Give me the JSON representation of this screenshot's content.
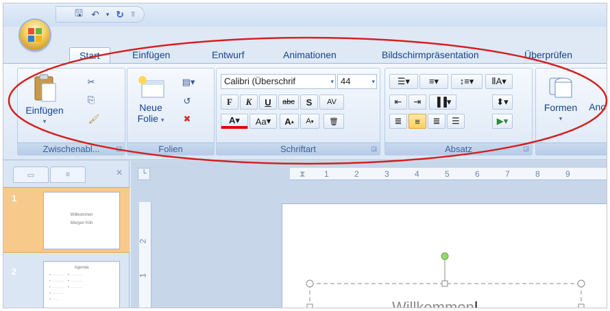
{
  "qat": {
    "icons": [
      "save-icon",
      "undo-icon",
      "redo-icon",
      "customize-icon"
    ]
  },
  "tabs": [
    {
      "label": "Start"
    },
    {
      "label": "Einfügen"
    },
    {
      "label": "Entwurf"
    },
    {
      "label": "Animationen"
    },
    {
      "label": "Bildschirmpräsentation"
    },
    {
      "label": "Überprüfen"
    }
  ],
  "groups": {
    "clipboard": {
      "label": "Zwischenabl...",
      "paste": "Einfügen"
    },
    "slides": {
      "label": "Folien",
      "new_slide_1": "Neue",
      "new_slide_2": "Folie"
    },
    "font": {
      "label": "Schriftart",
      "font_name": "Calibri (Überschrif",
      "font_size": "44",
      "bold": "F",
      "italic": "K",
      "underline": "U",
      "strike": "abc",
      "shadow": "S",
      "spacing": "AV",
      "case": "Aa",
      "grow": "A",
      "shrink": "A"
    },
    "paragraph": {
      "label": "Absatz"
    },
    "drawing": {
      "shapes": "Formen",
      "arrange": "Anor"
    }
  },
  "ruler": {
    "h_marks": [
      "1",
      "2",
      "3",
      "4",
      "5",
      "6",
      "7",
      "8",
      "9"
    ],
    "v_marks": [
      "2",
      "1"
    ]
  },
  "thumbnails": [
    {
      "number": "1",
      "title": "Willkommen",
      "subtitle": "Morgen früh"
    },
    {
      "number": "2",
      "title": "Agenda"
    }
  ],
  "slide": {
    "title": "Willkommen"
  },
  "colors": {
    "accent_red": "#d42020",
    "ribbon_blue": "#15428b",
    "selected_thumb": "#f7c98a"
  }
}
